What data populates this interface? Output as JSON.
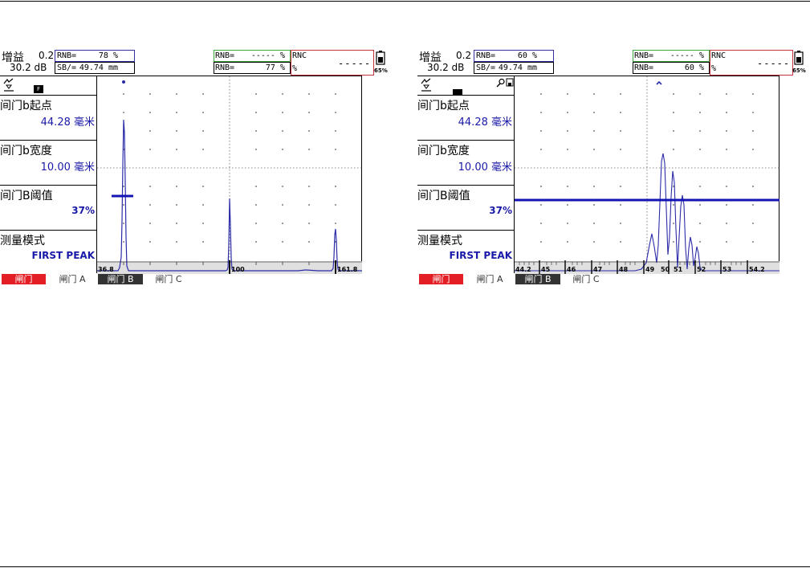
{
  "screens": [
    {
      "gain_label": "增益",
      "gain_step": "0.2",
      "gain_db": "30.2 dB",
      "readouts": {
        "r1_label": "RNB=",
        "r1_value": "78 %",
        "r2_label": "SB/=",
        "r2_value": "49.74 mm",
        "r3_label": "RNB=",
        "r3_value": "----- %",
        "r4_label": "RNB=",
        "r4_value": "77 %",
        "r5_label": "RNC",
        "r5_value": "-----",
        "r6_label": "%"
      },
      "battery": "65%",
      "status_badge": "F",
      "menu": [
        {
          "label": "间门b起点",
          "value": "44.28 毫米"
        },
        {
          "label": "间门b宽度",
          "value": "10.00 毫米"
        },
        {
          "label": "间门B阈值",
          "value": "37%"
        },
        {
          "label": "测量模式",
          "value": "FIRST PEAK"
        }
      ],
      "axis_ticks": [
        "36.8",
        "100",
        "161.8"
      ],
      "tabs": [
        "闸门",
        "闸门 A",
        "闸门 B",
        "闸门 C"
      ],
      "gate_level_percent": 37
    },
    {
      "gain_label": "增益",
      "gain_step": "0.2",
      "gain_db": "30.2 dB",
      "readouts": {
        "r1_label": "RNB=",
        "r1_value": "60 %",
        "r2_label": "SB/=",
        "r2_value": "49.74 mm",
        "r3_label": "RNB=",
        "r3_value": "----- %",
        "r4_label": "RNB=",
        "r4_value": "60 %",
        "r5_label": "RNC",
        "r5_value": "-----",
        "r6_label": "%"
      },
      "battery": "65%",
      "status_badge": "",
      "menu": [
        {
          "label": "间门b起点",
          "value": "44.28 毫米"
        },
        {
          "label": "间门b宽度",
          "value": "10.00 毫米"
        },
        {
          "label": "间门B阈值",
          "value": "37%"
        },
        {
          "label": "测量模式",
          "value": "FIRST PEAK"
        }
      ],
      "axis_ticks": [
        "44.2",
        "45",
        "46",
        "47",
        "48",
        "49",
        "50",
        "51",
        "52",
        "53",
        "54.2"
      ],
      "tabs": [
        "闸门",
        "闸门 A",
        "闸门 B",
        "闸门 C"
      ],
      "gate_level_percent": 37
    }
  ],
  "colors": {
    "trace": "#2b2ba8",
    "gate": "#1414b4",
    "tab_active": "#e31e24",
    "tab_selected": "#333333",
    "menu_value": "#1a1aa8",
    "readout_green": "#3aa83a",
    "readout_red": "#c8323c",
    "readout_blue": "#3232a0"
  },
  "icons": [
    "rectify-icon",
    "freeze-icon",
    "zoom-icon",
    "save-icon",
    "battery-icon"
  ]
}
